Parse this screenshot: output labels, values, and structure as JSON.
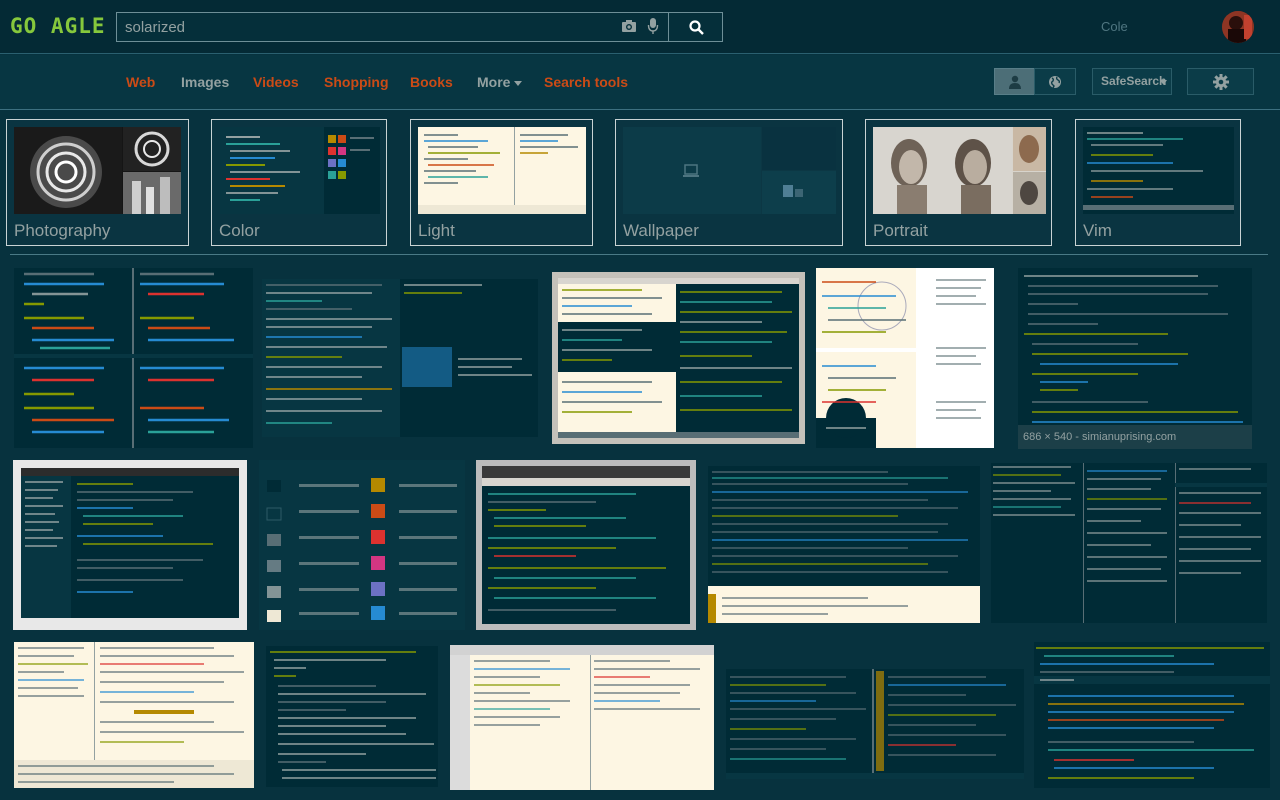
{
  "logo": "GO AGLE",
  "search": {
    "query": "solarized"
  },
  "user": {
    "name": "Cole"
  },
  "nav": {
    "web": "Web",
    "images": "Images",
    "videos": "Videos",
    "shopping": "Shopping",
    "books": "Books",
    "more": "More",
    "search_tools": "Search tools",
    "safesearch": "SafeSearch"
  },
  "chips": [
    {
      "label": "Photography"
    },
    {
      "label": "Color"
    },
    {
      "label": "Light"
    },
    {
      "label": "Wallpaper"
    },
    {
      "label": "Portrait"
    },
    {
      "label": "Vim"
    }
  ],
  "hover_info": {
    "dims": "686 × 540",
    "site": "simianuprising.com"
  },
  "colors": {
    "base03": "#002b36",
    "base02": "#073642",
    "base0": "#839496",
    "base1": "#93a1a1",
    "base2": "#eee8d5",
    "base3": "#fdf6e3",
    "yellow": "#b58900",
    "orange": "#cb4b16",
    "red": "#dc322f",
    "magenta": "#d33682",
    "violet": "#6c71c4",
    "blue": "#268bd2",
    "cyan": "#2aa198",
    "green": "#859900"
  },
  "icons": [
    "camera-icon",
    "microphone-icon",
    "search-icon",
    "person-icon",
    "globe-icon",
    "gear-icon",
    "caret-down-icon"
  ]
}
